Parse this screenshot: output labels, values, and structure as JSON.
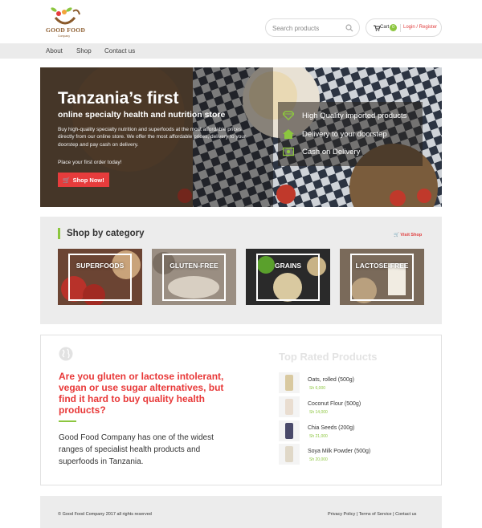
{
  "header": {
    "logo_text": "GOOD FOOD",
    "logo_sub": "Company",
    "search_placeholder": "Search products",
    "cart_label": "Cart",
    "cart_count": "0",
    "login_label": "Login / Register"
  },
  "nav": [
    {
      "label": "About"
    },
    {
      "label": "Shop"
    },
    {
      "label": "Contact us"
    }
  ],
  "hero": {
    "title": "Tanzania’s first",
    "subtitle": "online specialty health and nutrition store",
    "description": "Buy high-quality specialty nutrition and superfoods at the most affordable prices directly from our online store. We offer the most affordable prices, delivery to your doorstep and pay cash on delivery.",
    "cta_text": "Place your first order today!",
    "button_label": "Shop Now!",
    "features": [
      {
        "icon": "diamond-icon",
        "label": "High Quality imported products"
      },
      {
        "icon": "home-icon",
        "label": "Delivery to your doorstep"
      },
      {
        "icon": "money-icon",
        "label": "Cash on Delivery"
      }
    ]
  },
  "categories": {
    "title": "Shop by category",
    "visit_shop": "Visit Shop",
    "items": [
      {
        "label": "SUPERFOODS"
      },
      {
        "label": "GLUTEN-FREE"
      },
      {
        "label": "GRAINS"
      },
      {
        "label": "LACTOSE-FREE"
      }
    ]
  },
  "info": {
    "question": "Are you gluten or lactose intolerant, vegan or use sugar alternatives, but find it hard to buy quality health products?",
    "text": "Good Food Company has one of the widest ranges of specialist health products and superfoods in Tanzania."
  },
  "top_rated": {
    "title": "Top Rated Products",
    "products": [
      {
        "name": "Oats, rolled (500g)",
        "price": "Sh 6,000",
        "color": "#d9c9a0"
      },
      {
        "name": "Coconut Flour (500g)",
        "price": "Sh 14,000",
        "color": "#f0e6d8"
      },
      {
        "name": "Chia Seeds (200g)",
        "price": "Sh 21,000",
        "color": "#4a4a6a"
      },
      {
        "name": "Soya Milk Powder (500g)",
        "price": "Sh 20,000",
        "color": "#e8e0d0"
      }
    ]
  },
  "footer": {
    "copyright": "© Good Food Company 2017 all rights reserved",
    "links": [
      {
        "label": "Privacy Policy"
      },
      {
        "label": "Terms of Service"
      },
      {
        "label": "Contact us"
      }
    ]
  },
  "colors": {
    "accent_red": "#e63c3c",
    "accent_green": "#8cc63f"
  }
}
